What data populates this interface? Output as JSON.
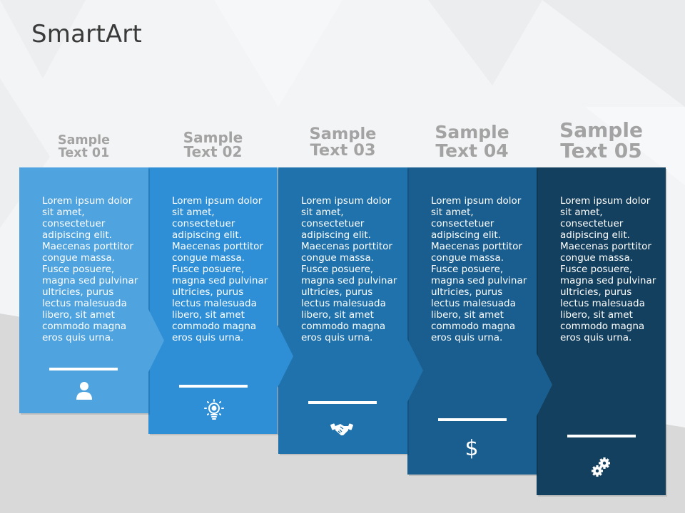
{
  "slide": {
    "title": "SmartArt"
  },
  "steps": [
    {
      "heading_line1": "Sample",
      "heading_line2": "Text 01",
      "body": "Lorem ipsum dolor sit amet, consectetuer adipiscing elit. Maecenas porttitor congue massa. Fusce posuere, magna sed pulvinar ultricies, purus lectus malesuada libero, sit amet commodo magna eros quis urna.",
      "icon": "user-icon",
      "color": "#4fa3de"
    },
    {
      "heading_line1": "Sample",
      "heading_line2": "Text 02",
      "body": "Lorem ipsum dolor sit amet, consectetuer adipiscing elit. Maecenas porttitor congue massa. Fusce posuere, magna sed pulvinar ultricies, purus lectus malesuada libero, sit amet commodo magna eros quis urna.",
      "icon": "lightbulb-icon",
      "color": "#2e8fd6"
    },
    {
      "heading_line1": "Sample",
      "heading_line2": "Text 03",
      "body": "Lorem ipsum dolor sit amet, consectetuer adipiscing elit. Maecenas porttitor congue massa. Fusce posuere, magna sed pulvinar ultricies, purus lectus malesuada libero, sit amet commodo magna eros quis urna.",
      "icon": "handshake-icon",
      "color": "#1f72ac"
    },
    {
      "heading_line1": "Sample",
      "heading_line2": "Text 04",
      "body": "Lorem ipsum dolor sit amet, consectetuer adipiscing elit. Maecenas porttitor congue massa. Fusce posuere, magna sed pulvinar ultricies, purus lectus malesuada libero, sit amet commodo magna eros quis urna.",
      "icon": "dollar-icon",
      "color": "#195e8f"
    },
    {
      "heading_line1": "Sample",
      "heading_line2": "Text 05",
      "body": "Lorem ipsum dolor sit amet, consectetuer adipiscing elit. Maecenas porttitor congue massa. Fusce posuere, magna sed pulvinar ultricies, purus lectus malesuada libero, sit amet commodo magna eros quis urna.",
      "icon": "gears-icon",
      "color": "#14405f"
    }
  ]
}
